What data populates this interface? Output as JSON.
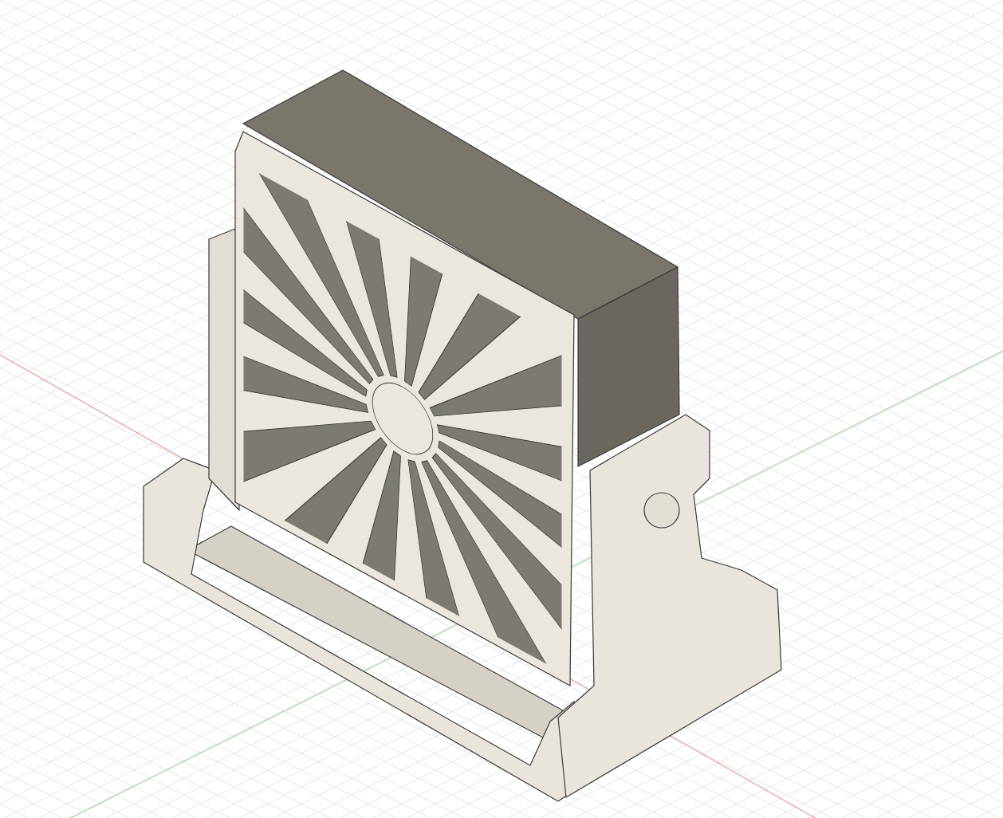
{
  "viewport": {
    "axes": [
      {
        "kind": "x",
        "color": "#e89a9a"
      },
      {
        "kind": "y",
        "color": "#9ddc9d"
      }
    ]
  }
}
